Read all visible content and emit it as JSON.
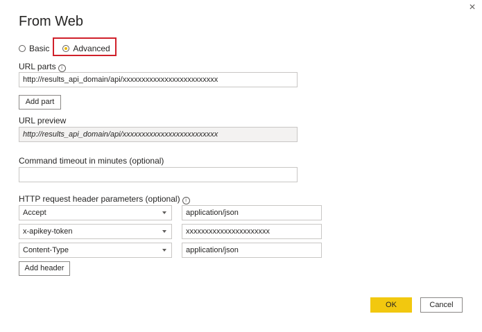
{
  "dialog": {
    "title": "From Web",
    "close_icon": "×"
  },
  "mode": {
    "basic_label": "Basic",
    "advanced_label": "Advanced",
    "selected": "Advanced"
  },
  "url_parts": {
    "label": "URL parts",
    "value": "http://results_api_domain/api/xxxxxxxxxxxxxxxxxxxxxxxxx",
    "add_part_label": "Add part"
  },
  "url_preview": {
    "label": "URL preview",
    "value": "http://results_api_domain/api/xxxxxxxxxxxxxxxxxxxxxxxxx"
  },
  "timeout": {
    "label": "Command timeout in minutes (optional)",
    "value": ""
  },
  "headers": {
    "label": "HTTP request header parameters (optional)",
    "rows": [
      {
        "name": "Accept",
        "value": "application/json"
      },
      {
        "name": "x-apikey-token",
        "value": "xxxxxxxxxxxxxxxxxxxxxx"
      },
      {
        "name": "Content-Type",
        "value": "application/json"
      }
    ],
    "add_header_label": "Add header"
  },
  "footer": {
    "ok_label": "OK",
    "cancel_label": "Cancel"
  },
  "colors": {
    "accent": "#f2c80f",
    "highlight": "#d0202a"
  }
}
